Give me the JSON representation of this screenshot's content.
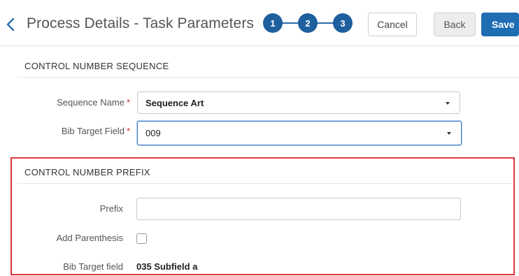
{
  "header": {
    "title": "Process Details - Task Parameters",
    "steps": [
      "1",
      "2",
      "3"
    ],
    "cancel_label": "Cancel",
    "back_label": "Back",
    "save_label": "Save",
    "step_color": "#1e5f9e",
    "save_color": "#1f6db3"
  },
  "sequence_section": {
    "title": "CONTROL NUMBER SEQUENCE",
    "sequence_name": {
      "label": "Sequence Name",
      "required_mark": "*",
      "value": "Sequence Art"
    },
    "bib_target_field": {
      "label": "Bib Target Field",
      "required_mark": "*",
      "value": "009"
    }
  },
  "prefix_section": {
    "title": "CONTROL NUMBER PREFIX",
    "highlight_color": "#e0383e",
    "prefix": {
      "label": "Prefix",
      "value": "",
      "placeholder": ""
    },
    "add_parenthesis": {
      "label": "Add Parenthesis",
      "checked": false
    },
    "bib_target_field": {
      "label": "Bib Target field",
      "value": "035 Subfield a"
    }
  }
}
